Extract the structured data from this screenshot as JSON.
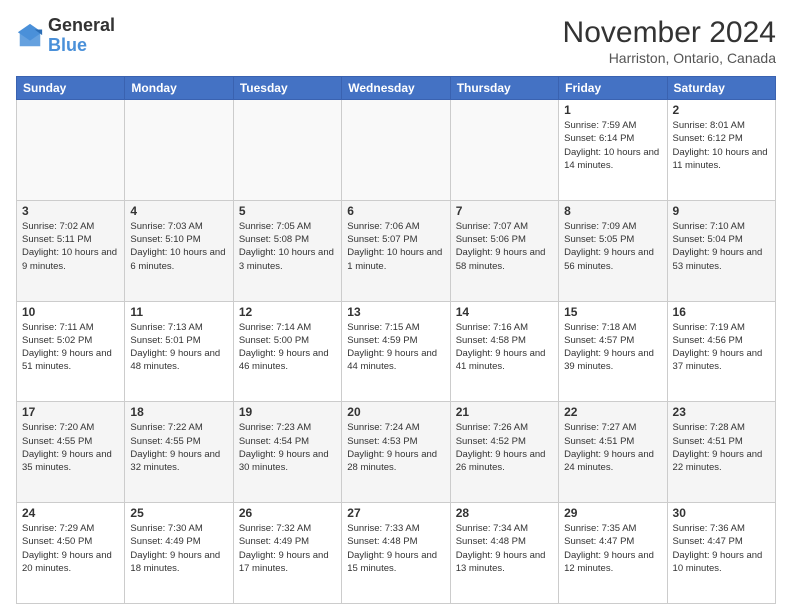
{
  "header": {
    "logo_line1": "General",
    "logo_line2": "Blue",
    "month_title": "November 2024",
    "location": "Harriston, Ontario, Canada"
  },
  "days_of_week": [
    "Sunday",
    "Monday",
    "Tuesday",
    "Wednesday",
    "Thursday",
    "Friday",
    "Saturday"
  ],
  "weeks": [
    [
      {
        "day": "",
        "info": ""
      },
      {
        "day": "",
        "info": ""
      },
      {
        "day": "",
        "info": ""
      },
      {
        "day": "",
        "info": ""
      },
      {
        "day": "",
        "info": ""
      },
      {
        "day": "1",
        "info": "Sunrise: 7:59 AM\nSunset: 6:14 PM\nDaylight: 10 hours and 14 minutes."
      },
      {
        "day": "2",
        "info": "Sunrise: 8:01 AM\nSunset: 6:12 PM\nDaylight: 10 hours and 11 minutes."
      }
    ],
    [
      {
        "day": "3",
        "info": "Sunrise: 7:02 AM\nSunset: 5:11 PM\nDaylight: 10 hours and 9 minutes."
      },
      {
        "day": "4",
        "info": "Sunrise: 7:03 AM\nSunset: 5:10 PM\nDaylight: 10 hours and 6 minutes."
      },
      {
        "day": "5",
        "info": "Sunrise: 7:05 AM\nSunset: 5:08 PM\nDaylight: 10 hours and 3 minutes."
      },
      {
        "day": "6",
        "info": "Sunrise: 7:06 AM\nSunset: 5:07 PM\nDaylight: 10 hours and 1 minute."
      },
      {
        "day": "7",
        "info": "Sunrise: 7:07 AM\nSunset: 5:06 PM\nDaylight: 9 hours and 58 minutes."
      },
      {
        "day": "8",
        "info": "Sunrise: 7:09 AM\nSunset: 5:05 PM\nDaylight: 9 hours and 56 minutes."
      },
      {
        "day": "9",
        "info": "Sunrise: 7:10 AM\nSunset: 5:04 PM\nDaylight: 9 hours and 53 minutes."
      }
    ],
    [
      {
        "day": "10",
        "info": "Sunrise: 7:11 AM\nSunset: 5:02 PM\nDaylight: 9 hours and 51 minutes."
      },
      {
        "day": "11",
        "info": "Sunrise: 7:13 AM\nSunset: 5:01 PM\nDaylight: 9 hours and 48 minutes."
      },
      {
        "day": "12",
        "info": "Sunrise: 7:14 AM\nSunset: 5:00 PM\nDaylight: 9 hours and 46 minutes."
      },
      {
        "day": "13",
        "info": "Sunrise: 7:15 AM\nSunset: 4:59 PM\nDaylight: 9 hours and 44 minutes."
      },
      {
        "day": "14",
        "info": "Sunrise: 7:16 AM\nSunset: 4:58 PM\nDaylight: 9 hours and 41 minutes."
      },
      {
        "day": "15",
        "info": "Sunrise: 7:18 AM\nSunset: 4:57 PM\nDaylight: 9 hours and 39 minutes."
      },
      {
        "day": "16",
        "info": "Sunrise: 7:19 AM\nSunset: 4:56 PM\nDaylight: 9 hours and 37 minutes."
      }
    ],
    [
      {
        "day": "17",
        "info": "Sunrise: 7:20 AM\nSunset: 4:55 PM\nDaylight: 9 hours and 35 minutes."
      },
      {
        "day": "18",
        "info": "Sunrise: 7:22 AM\nSunset: 4:55 PM\nDaylight: 9 hours and 32 minutes."
      },
      {
        "day": "19",
        "info": "Sunrise: 7:23 AM\nSunset: 4:54 PM\nDaylight: 9 hours and 30 minutes."
      },
      {
        "day": "20",
        "info": "Sunrise: 7:24 AM\nSunset: 4:53 PM\nDaylight: 9 hours and 28 minutes."
      },
      {
        "day": "21",
        "info": "Sunrise: 7:26 AM\nSunset: 4:52 PM\nDaylight: 9 hours and 26 minutes."
      },
      {
        "day": "22",
        "info": "Sunrise: 7:27 AM\nSunset: 4:51 PM\nDaylight: 9 hours and 24 minutes."
      },
      {
        "day": "23",
        "info": "Sunrise: 7:28 AM\nSunset: 4:51 PM\nDaylight: 9 hours and 22 minutes."
      }
    ],
    [
      {
        "day": "24",
        "info": "Sunrise: 7:29 AM\nSunset: 4:50 PM\nDaylight: 9 hours and 20 minutes."
      },
      {
        "day": "25",
        "info": "Sunrise: 7:30 AM\nSunset: 4:49 PM\nDaylight: 9 hours and 18 minutes."
      },
      {
        "day": "26",
        "info": "Sunrise: 7:32 AM\nSunset: 4:49 PM\nDaylight: 9 hours and 17 minutes."
      },
      {
        "day": "27",
        "info": "Sunrise: 7:33 AM\nSunset: 4:48 PM\nDaylight: 9 hours and 15 minutes."
      },
      {
        "day": "28",
        "info": "Sunrise: 7:34 AM\nSunset: 4:48 PM\nDaylight: 9 hours and 13 minutes."
      },
      {
        "day": "29",
        "info": "Sunrise: 7:35 AM\nSunset: 4:47 PM\nDaylight: 9 hours and 12 minutes."
      },
      {
        "day": "30",
        "info": "Sunrise: 7:36 AM\nSunset: 4:47 PM\nDaylight: 9 hours and 10 minutes."
      }
    ]
  ]
}
